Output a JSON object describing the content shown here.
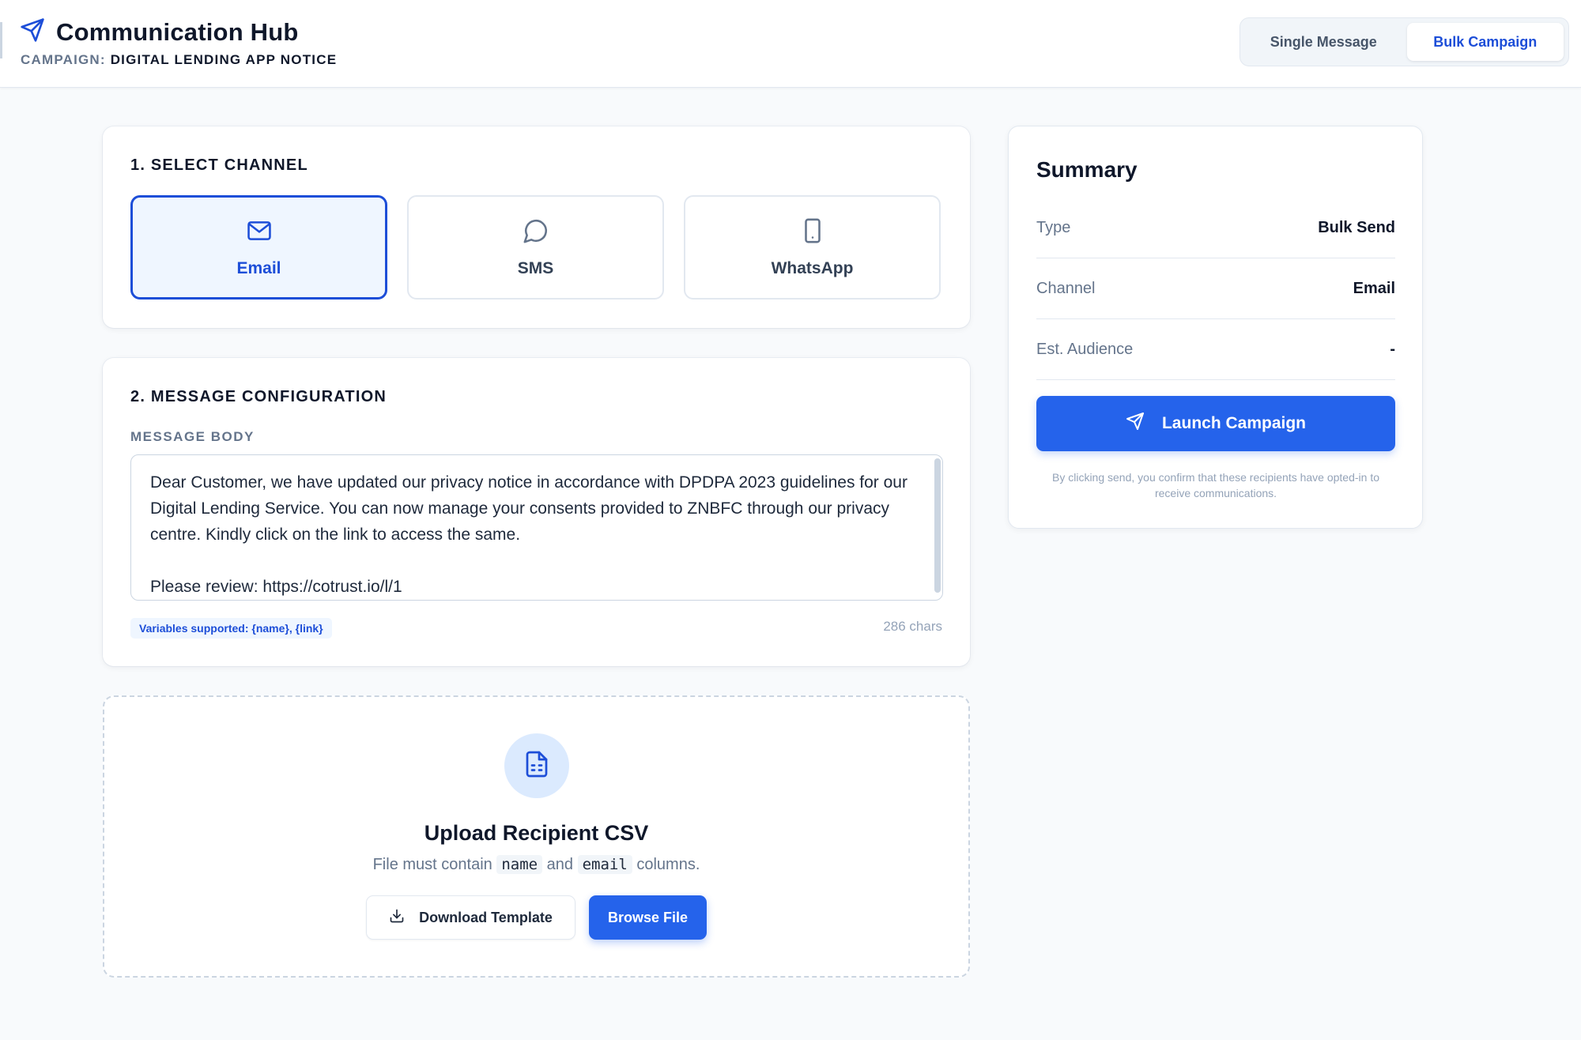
{
  "header": {
    "title": "Communication Hub",
    "campaign_key": "CAMPAIGN:",
    "campaign_value": "DIGITAL LENDING APP NOTICE",
    "modes": [
      {
        "label": "Single Message",
        "active": false
      },
      {
        "label": "Bulk Campaign",
        "active": true
      }
    ]
  },
  "channel_section": {
    "title": "1. SELECT CHANNEL",
    "options": [
      {
        "label": "Email",
        "icon": "mail-icon",
        "selected": true
      },
      {
        "label": "SMS",
        "icon": "chat-bubble-icon",
        "selected": false
      },
      {
        "label": "WhatsApp",
        "icon": "mobile-phone-icon",
        "selected": false
      }
    ]
  },
  "message_section": {
    "title": "2. MESSAGE CONFIGURATION",
    "field_label": "MESSAGE BODY",
    "body": "Dear Customer, we have updated our privacy notice in accordance with DPDPA 2023 guidelines for our Digital Lending Service. You can now manage your consents provided to ZNBFC through our privacy centre. Kindly click on the link to access the same.\n\nPlease review: https://cotrust.io/l/1",
    "variables_badge": "Variables supported: {name}, {link}",
    "char_count": "286 chars"
  },
  "upload_section": {
    "icon": "file-spreadsheet-icon",
    "title": "Upload Recipient CSV",
    "desc_prefix": "File must contain",
    "col1": "name",
    "desc_and": "and",
    "col2": "email",
    "desc_suffix": "columns.",
    "download_label": "Download Template",
    "browse_label": "Browse File"
  },
  "summary": {
    "title": "Summary",
    "rows": [
      {
        "key": "Type",
        "value": "Bulk Send"
      },
      {
        "key": "Channel",
        "value": "Email"
      },
      {
        "key": "Est. Audience",
        "value": "-"
      }
    ],
    "launch_label": "Launch Campaign",
    "disclaimer": "By clicking send, you confirm that these recipients have opted-in to receive communications."
  },
  "colors": {
    "accent": "#2563eb",
    "accent_dark": "#1d4ed8",
    "background": "#f8fafc",
    "muted_text": "#64748b"
  }
}
